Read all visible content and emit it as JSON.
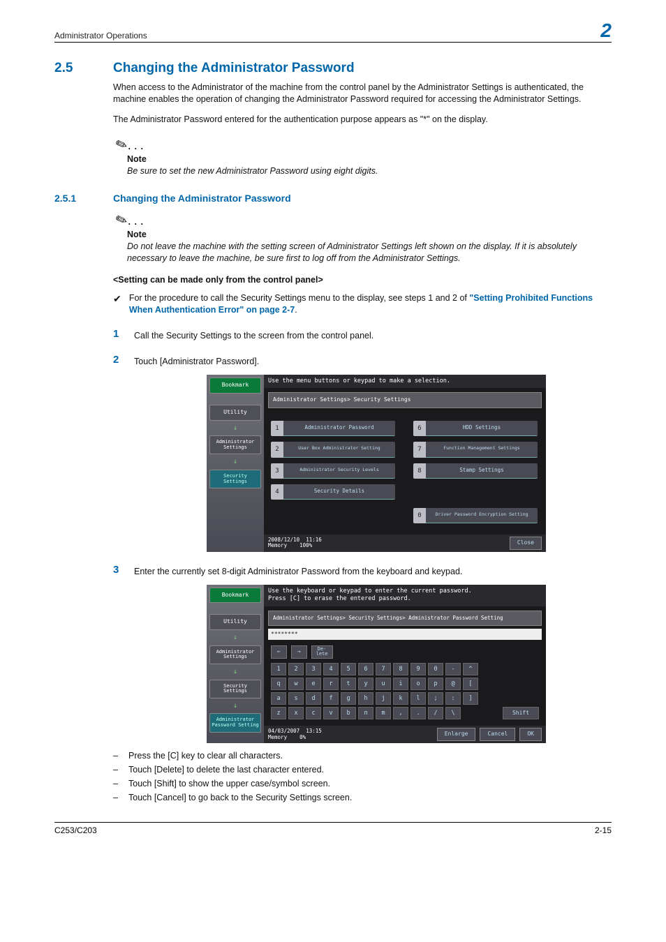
{
  "header": {
    "left": "Administrator Operations",
    "right": "2"
  },
  "sec": {
    "num": "2.5",
    "title": "Changing the Administrator Password"
  },
  "para1": "When access to the Administrator of the machine from the control panel by the Administrator Settings is authenticated, the machine enables the operation of changing the Administrator Password required for accessing the Administrator Settings.",
  "para2": "The Administrator Password entered for the authentication purpose appears as \"*\" on the display.",
  "note1": {
    "label": "Note",
    "body": "Be sure to set the new Administrator Password using eight digits."
  },
  "sub": {
    "num": "2.5.1",
    "title": "Changing the Administrator Password"
  },
  "note2": {
    "label": "Note",
    "body": "Do not leave the machine with the setting screen of Administrator Settings left shown on the display. If it is absolutely necessary to leave the machine, be sure first to log off from the Administrator Settings."
  },
  "setting_heading": "<Setting can be made only from the control panel>",
  "check_line_a": "For the procedure to call the Security Settings menu to the display, see steps 1 and 2 of ",
  "check_link": "\"Setting Prohibited Functions When Authentication Error\" on page 2-7",
  "check_line_b": ".",
  "step1": {
    "n": "1",
    "t": "Call the Security Settings to the screen from the control panel."
  },
  "step2": {
    "n": "2",
    "t": "Touch [Administrator Password]."
  },
  "step3": {
    "n": "3",
    "t": "Enter the currently set 8-digit Administrator Password from the keyboard and keypad."
  },
  "ss1": {
    "instruction": "Use the menu buttons or keypad to make a selection.",
    "crumb": "Administrator Settings> Security Settings",
    "bookmark": "Bookmark",
    "nav": [
      "Utility",
      "Administrator Settings",
      "Security Settings"
    ],
    "items": [
      {
        "n": "1",
        "l": "Administrator Password"
      },
      {
        "n": "2",
        "l": "User Box Administrator Setting"
      },
      {
        "n": "3",
        "l": "Administrator Security Levels"
      },
      {
        "n": "4",
        "l": "Security Details"
      },
      {
        "n": "6",
        "l": "HDD Settings"
      },
      {
        "n": "7",
        "l": "Function Management Settings"
      },
      {
        "n": "8",
        "l": "Stamp Settings"
      },
      {
        "n": "0",
        "l": "Driver Password Encryption Setting"
      }
    ],
    "foot_date": "2008/12/10",
    "foot_time": "11:16",
    "foot_mem": "Memory",
    "foot_mem_v": "100%",
    "close": "Close"
  },
  "ss2": {
    "instruction": "Use the keyboard or keypad to enter the current password.\nPress [C] to erase the entered password.",
    "crumb": "Administrator Settings> Security Settings> Administrator Password Setting",
    "bookmark": "Bookmark",
    "nav": [
      "Utility",
      "Administrator Settings",
      "Security Settings",
      "Administrator Password Setting"
    ],
    "input": "********",
    "arrows": [
      "←",
      "→"
    ],
    "delete": "De-\nlete",
    "row1": [
      "1",
      "2",
      "3",
      "4",
      "5",
      "6",
      "7",
      "8",
      "9",
      "0",
      "-",
      "^"
    ],
    "row2": [
      "q",
      "w",
      "e",
      "r",
      "t",
      "y",
      "u",
      "i",
      "o",
      "p",
      "@",
      "["
    ],
    "row3": [
      "a",
      "s",
      "d",
      "f",
      "g",
      "h",
      "j",
      "k",
      "l",
      ";",
      ":",
      "]"
    ],
    "row4": [
      "z",
      "x",
      "c",
      "v",
      "b",
      "n",
      "m",
      ",",
      ".",
      "/",
      "\\"
    ],
    "shift": "Shift",
    "enlarge": "Enlarge",
    "cancel": "Cancel",
    "ok": "OK",
    "foot_date": "04/03/2007",
    "foot_time": "13:15",
    "foot_mem": "Memory",
    "foot_mem_v": "0%"
  },
  "post": [
    "Press the [C] key to clear all characters.",
    "Touch [Delete] to delete the last character entered.",
    "Touch [Shift] to show the upper case/symbol screen.",
    "Touch [Cancel] to go back to the Security Settings screen."
  ],
  "footer": {
    "left": "C253/C203",
    "right": "2-15"
  }
}
